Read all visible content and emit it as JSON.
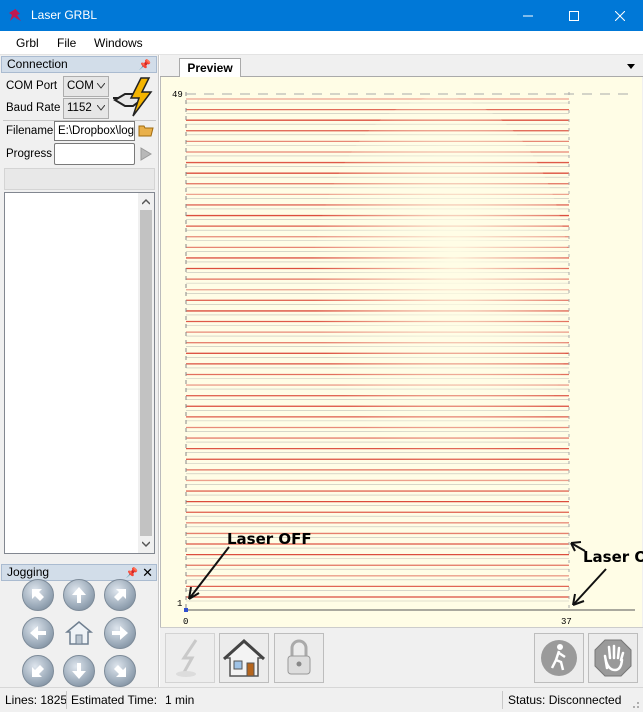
{
  "window": {
    "title": "Laser GRBL"
  },
  "menu": [
    {
      "label": "Grbl"
    },
    {
      "label": "File"
    },
    {
      "label": "Windows"
    }
  ],
  "connection": {
    "header": "Connection",
    "com_port_label": "COM Port",
    "com_port_value": "COM",
    "baud_rate_label": "Baud Rate",
    "baud_rate_value": "1152",
    "filename_label": "Filename",
    "filename_value": "E:\\Dropbox\\logl",
    "progress_label": "Progress"
  },
  "jogging": {
    "header": "Jogging"
  },
  "preview": {
    "tab_label": "Preview",
    "y_max_label": "49",
    "y_min_label": "1",
    "x_min_label": "0",
    "x_max_label": "37",
    "annotation_left": "Laser OFF",
    "annotation_right": "Laser OFF"
  },
  "status": {
    "lines": "Lines: 1825",
    "estimated_time_label": "Estimated Time:",
    "estimated_time_value": "1 min",
    "connection_status": "Status: Disconnected"
  },
  "colors": {
    "titlebar": "#0078d7",
    "canvas_bg": "#fffde6",
    "burn_line": "#d83a2a",
    "travel_line": "#999999"
  }
}
